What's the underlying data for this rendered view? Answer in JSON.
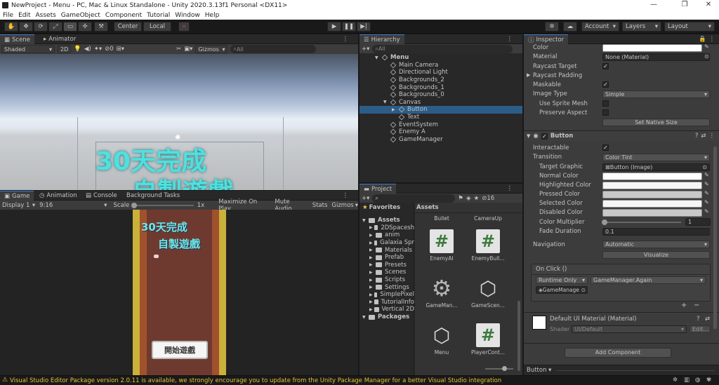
{
  "window": {
    "title": "NewProject - Menu - PC, Mac & Linux Standalone - Unity 2020.3.13f1 Personal <DX11>",
    "min": "—",
    "max": "❐",
    "close": "✕"
  },
  "menu": [
    "File",
    "Edit",
    "Assets",
    "GameObject",
    "Component",
    "Tutorial",
    "Window",
    "Help"
  ],
  "toolbar": {
    "pivot": "Center",
    "space": "Local",
    "account": "Account",
    "layers": "Layers",
    "layout": "Layout"
  },
  "scene": {
    "tabs": [
      "Scene",
      "Animator"
    ],
    "shading": "Shaded",
    "mode2d": "2D",
    "hidden_count": "0",
    "gizmos": "Gizmos",
    "search_placeholder": "All",
    "title_text": "30天完成",
    "title_text2": "自製遊戲"
  },
  "game": {
    "tabs": [
      "Game",
      "Animation",
      "Console",
      "Background Tasks"
    ],
    "display": "Display 1",
    "aspect": "9:16",
    "scale_label": "Scale",
    "scale_value": "1x",
    "buttons": [
      "Maximize On Play",
      "Mute Audio",
      "Stats",
      "Gizmos"
    ],
    "title1": "30天完成",
    "title2": "自製遊戲",
    "start_button": "開始遊戲"
  },
  "hierarchy": {
    "tab": "Hierarchy",
    "search_placeholder": "All",
    "items": [
      {
        "label": "Menu",
        "depth": 0,
        "arrow": "▼",
        "bold": true
      },
      {
        "label": "Main Camera",
        "depth": 1
      },
      {
        "label": "Directional Light",
        "depth": 1
      },
      {
        "label": "Backgrounds_2",
        "depth": 1
      },
      {
        "label": "Backgrounds_1",
        "depth": 1
      },
      {
        "label": "Backgrounds_0",
        "depth": 1
      },
      {
        "label": "Canvas",
        "depth": 1,
        "arrow": "▼"
      },
      {
        "label": "Button",
        "depth": 2,
        "arrow": "▶",
        "selected": true
      },
      {
        "label": "Text",
        "depth": 2
      },
      {
        "label": "EventSystem",
        "depth": 1
      },
      {
        "label": "Enemy A",
        "depth": 1
      },
      {
        "label": "GameManager",
        "depth": 1
      }
    ]
  },
  "project": {
    "tab": "Project",
    "count": "16",
    "favorites": "Favorites",
    "assets_header": "Assets",
    "tree": [
      {
        "label": "Assets",
        "depth": 0,
        "bold": true
      },
      {
        "label": "2DSpacesh",
        "depth": 1
      },
      {
        "label": "anim",
        "depth": 1
      },
      {
        "label": "Galaxia Spr",
        "depth": 1
      },
      {
        "label": "Materials",
        "depth": 1
      },
      {
        "label": "Prefab",
        "depth": 1
      },
      {
        "label": "Presets",
        "depth": 1
      },
      {
        "label": "Scenes",
        "depth": 1
      },
      {
        "label": "Scripts",
        "depth": 1
      },
      {
        "label": "Settings",
        "depth": 1
      },
      {
        "label": "SimplePixel",
        "depth": 1
      },
      {
        "label": "TutorialInfo",
        "depth": 1
      },
      {
        "label": "Vertical 2D",
        "depth": 1
      },
      {
        "label": "Packages",
        "depth": 0,
        "bold": true
      }
    ],
    "grid_top": [
      "Bullet",
      "CameraUp"
    ],
    "grid": [
      {
        "label": "EnemyAI",
        "kind": "cs"
      },
      {
        "label": "EnemyBull...",
        "kind": "cs"
      },
      {
        "label": "GameMan...",
        "kind": "gear"
      },
      {
        "label": "GameScen...",
        "kind": "unity"
      },
      {
        "label": "Menu",
        "kind": "unity"
      },
      {
        "label": "PlayerCont...",
        "kind": "cs"
      }
    ]
  },
  "inspector": {
    "tab": "Inspector",
    "image": {
      "color_label": "Color",
      "material_label": "Material",
      "material_value": "None (Material)",
      "raycast_target": "Raycast Target",
      "raycast_padding": "Raycast Padding",
      "maskable": "Maskable",
      "image_type_label": "Image Type",
      "image_type_value": "Simple",
      "use_sprite_mesh": "Use Sprite Mesh",
      "preserve_aspect": "Preserve Aspect",
      "set_native_size": "Set Native Size"
    },
    "button": {
      "header": "Button",
      "interactable": "Interactable",
      "transition_label": "Transition",
      "transition_value": "Color Tint",
      "target_graphic_label": "Target Graphic",
      "target_graphic_value": "Button (Image)",
      "normal_color": "Normal Color",
      "highlighted_color": "Highlighted Color",
      "pressed_color": "Pressed Color",
      "selected_color": "Selected Color",
      "disabled_color": "Disabled Color",
      "color_multiplier": "Color Multiplier",
      "color_multiplier_value": "1",
      "fade_duration": "Fade Duration",
      "fade_duration_value": "0.1",
      "navigation_label": "Navigation",
      "navigation_value": "Automatic",
      "visualize": "Visualize",
      "onclick": "On Click ()",
      "runtime": "Runtime Only",
      "function": "GameManager.Again",
      "object": "GameManage",
      "plus": "+",
      "minus": "−"
    },
    "material": {
      "name": "Default UI Material (Material)",
      "shader_label": "Shader",
      "shader_value": "UI/Default",
      "edit": "Edit..."
    },
    "add_component": "Add Component",
    "footer": "Button ▾"
  },
  "status": {
    "message": "Visual Studio Editor Package version 2.0.11 is available, we strongly encourage you to update from the Unity Package Manager for a better Visual Studio integration"
  }
}
